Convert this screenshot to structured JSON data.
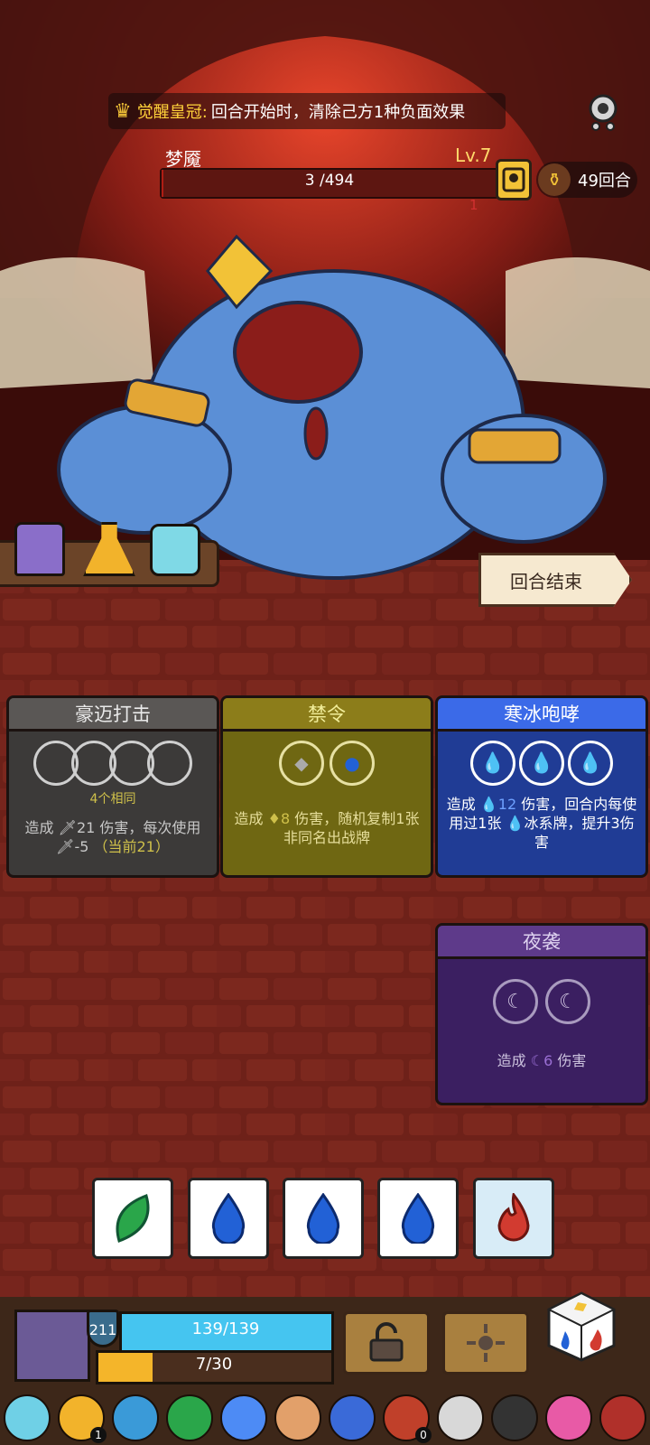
{
  "buff": {
    "name": "觉醒皇冠:",
    "description": "回合开始时，清除己方1种负面效果",
    "icon": "crown-icon"
  },
  "boss": {
    "name": "梦魇",
    "level": "Lv.7",
    "hp_text": "3 /494",
    "hp_fraction": 0.006,
    "status_text": "1"
  },
  "round": {
    "label": "49回合",
    "icon": "scroll-icon"
  },
  "end_turn": {
    "label": "回合结束"
  },
  "potions": [
    "purple-potion-icon",
    "orange-potion-icon",
    "cyan-potion-icon"
  ],
  "cards": [
    {
      "title": "豪迈打击",
      "slot_caption": "4个相同",
      "desc_prefix": "造成",
      "desc_value": "21",
      "desc_suffix": "伤害，每次使用",
      "desc_line2": "-5",
      "desc_current": "（当前21）",
      "theme": "#5a5755"
    },
    {
      "title": "禁令",
      "desc_prefix": "造成",
      "desc_value": "8",
      "desc_suffix": "伤害，随机复制1张非同名出战牌",
      "theme": "#8c7d1a"
    },
    {
      "title": "寒冰咆哮",
      "desc_prefix": "造成",
      "desc_value": "12",
      "desc_mid": "伤害，回合内每使用过1张",
      "desc_suffix": "冰系牌，提升3伤害",
      "theme": "#3b6ae8"
    },
    {
      "title": "夜袭",
      "desc_prefix": "造成",
      "desc_value": "6",
      "desc_suffix": "伤害",
      "theme": "#5e3a8a"
    }
  ],
  "dice": [
    "leaf-die-icon",
    "water-die-icon",
    "water-die-icon",
    "water-die-icon",
    "fire-die-icon"
  ],
  "player": {
    "shield": "211",
    "hp": "139/139",
    "hp_fraction": 1.0,
    "energy": "7/30",
    "energy_fraction": 0.233
  },
  "relics": [
    {
      "icon": "blue-ghost-relic-icon",
      "count": ""
    },
    {
      "icon": "gold-relic-icon",
      "count": "1"
    },
    {
      "icon": "teal-mask-relic-icon",
      "count": ""
    },
    {
      "icon": "leaf-relic-icon",
      "count": ""
    },
    {
      "icon": "water-drop-relic-icon",
      "count": ""
    },
    {
      "icon": "dancer-relic-icon",
      "count": ""
    },
    {
      "icon": "blue-fish-relic-icon",
      "count": ""
    },
    {
      "icon": "red-orb-relic-icon",
      "count": "0"
    },
    {
      "icon": "d20-relic-icon",
      "count": ""
    },
    {
      "icon": "black-armor-relic-icon",
      "count": ""
    },
    {
      "icon": "heart-relic-icon",
      "count": ""
    },
    {
      "icon": "red-hood-relic-icon",
      "count": ""
    }
  ],
  "colors": {
    "accent_yellow": "#f2c237",
    "ice_blue": "#3b6ae8",
    "hp_cyan": "#45c5f0",
    "energy_orange": "#f4b52a"
  }
}
